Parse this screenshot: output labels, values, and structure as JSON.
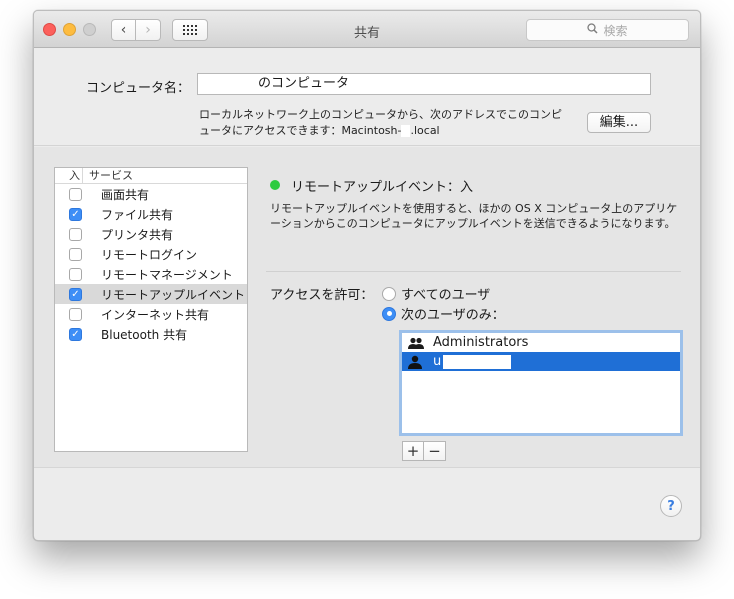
{
  "window": {
    "title": "共有",
    "search_placeholder": "検索"
  },
  "computer_name": {
    "label": "コンピュータ名：",
    "value": "のコンピュータ",
    "address_line1": "ローカルネットワーク上のコンピュータから、次のアドレスでこのコンピ",
    "address_line2_prefix": "ュータにアクセスできます：Macintosh-",
    "address_line2_suffix": ".local",
    "edit_button": "編集..."
  },
  "services": {
    "header_on": "入",
    "header_service": "サービス",
    "items": [
      {
        "label": "画面共有",
        "checked": false
      },
      {
        "label": "ファイル共有",
        "checked": true
      },
      {
        "label": "プリンタ共有",
        "checked": false
      },
      {
        "label": "リモートログイン",
        "checked": false
      },
      {
        "label": "リモートマネージメント",
        "checked": false
      },
      {
        "label": "リモートアップルイベント",
        "checked": true
      },
      {
        "label": "インターネット共有",
        "checked": false
      },
      {
        "label": "Bluetooth 共有",
        "checked": true
      }
    ]
  },
  "detail": {
    "status": "リモートアップルイベント：入",
    "status_color": "#2ecb40",
    "desc_line1": "リモートアップルイベントを使用すると、ほかの OS X コンピュータ上のアプリケ",
    "desc_line2": "ーションからこのコンピュータにアップルイベントを送信できるようになります。",
    "access_label": "アクセスを許可：",
    "radio_all": "すべてのユーザ",
    "radio_only": "次のユーザのみ：",
    "users": [
      {
        "name": "Administrators",
        "icon": "group-icon"
      },
      {
        "name": "u",
        "icon": "user-icon"
      }
    ],
    "add_label": "+",
    "remove_label": "−"
  },
  "help": "?",
  "accent_color": "#3d8ef6"
}
